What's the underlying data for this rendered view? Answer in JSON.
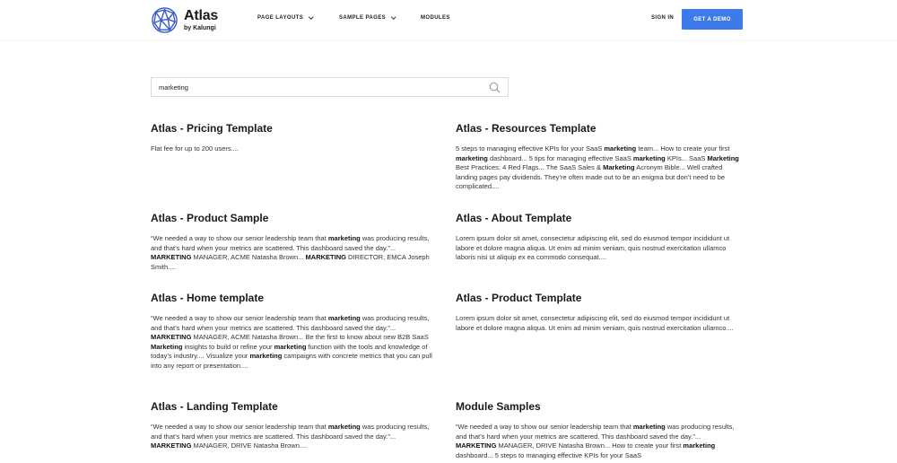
{
  "header": {
    "logo_name": "Atlas",
    "logo_sub": "by Kalungi",
    "nav": [
      "PAGE LAYOUTS",
      "SAMPLE PAGES",
      "MODULES"
    ],
    "signin": "SIGN IN",
    "cta": "GET A DEMO",
    "accent_color": "#3e7bea"
  },
  "search": {
    "value": "marketing",
    "icon": "search-icon"
  },
  "results": [
    {
      "title": "Atlas - Pricing Template",
      "snippet": "Flat fee for up to 200 users...."
    },
    {
      "title": "Atlas - Resources Template",
      "snippet": "5 steps to managing effective KPIs for your SaaS [[marketing]] team... How to create your first [[marketing]] dashboard... 5 tips for managing effective SaaS [[marketing]] KPIs... SaaS [[Marketing]] Best Practices: 4 Red Flags... The SaaS Sales & [[Marketing]] Acronym Bible... Well crafted landing pages pay dividends. They’re often made out to be an enigma but don’t need to be complicated...."
    },
    {
      "title": "Atlas - Product Sample",
      "snippet": "“We needed a way to show our senior leadership team that [[marketing]] was producing results, and that’s hard when your metrics are scattered. This dashboard saved the day.”... [[MARKETING]] MANAGER, ACME Natasha Brown... [[MARKETING]] DIRECTOR, EMCA Joseph Smith...."
    },
    {
      "title": "Atlas - About Template",
      "snippet": "Lorem ipsum dolor sit amet, consectetur adipiscing elit, sed do eiusmod tempor incididunt ut labore et dolore magna aliqua. Ut enim ad minim veniam, quis nostrud exercitation ullamco laboris nisi ut aliquip ex ea commodo consequat...."
    },
    {
      "title": "Atlas - Home template",
      "snippet": "“We needed a way to show our senior leadership team that [[marketing]] was producing results, and that’s hard when your metrics are scattered. This dashboard saved the day.”... [[MARKETING]] MANAGER, ACME Natasha Brown... Be the first to know about new B2B SaaS [[Marketing]] insights to build or refine your [[marketing]] function with the tools and knowledge of today’s industry.... Visualize your [[marketing]] campaigns with concrete metrics that you can pull into any report or presentation...."
    },
    {
      "title": "Atlas - Product Template",
      "snippet": "Lorem ipsum dolor sit amet, consectetur adipiscing elit, sed do eiusmod tempor incididunt ut labore et dolore magna aliqua. Ut enim ad minim veniam, quis nostrud exercitation ullamco...."
    },
    {
      "title": "Atlas - Landing Template",
      "snippet": "“We needed a way to show our senior leadership team that [[marketing]] was producing results, and that’s hard when your metrics are scattered. This dashboard saved the day.”... [[MARKETING]] MANAGER, DRIVE Natasha Brown...."
    },
    {
      "title": "Module Samples",
      "snippet": "“We needed a way to show our senior leadership team that [[marketing]] was producing results, and that’s hard when your metrics are scattered. This dashboard saved the day.”... [[MARKETING]] MANAGER, DRIVE Natasha Brown... How to create your first [[marketing]] dashboard... 5 steps to managing effective KPIs for your SaaS"
    }
  ]
}
